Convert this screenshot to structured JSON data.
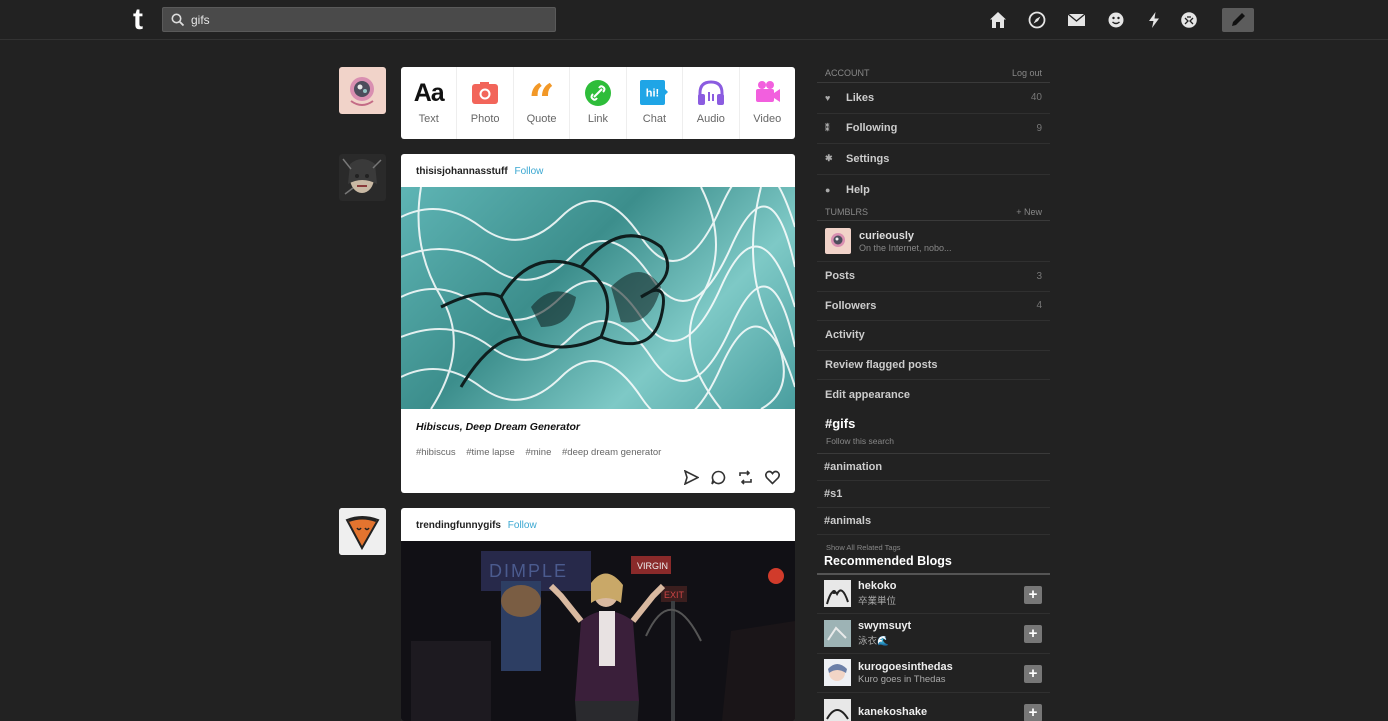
{
  "header": {
    "logo_text": "t",
    "search_value": "gifs",
    "nav_icons": [
      "home-icon",
      "explore-icon",
      "mail-icon",
      "emoji-icon",
      "bolt-icon",
      "account-icon",
      "compose-pencil-icon"
    ]
  },
  "composer": {
    "types": [
      {
        "label": "Text",
        "color": "#111111"
      },
      {
        "label": "Photo",
        "color": "#f2655a"
      },
      {
        "label": "Quote",
        "color": "#f29827"
      },
      {
        "label": "Link",
        "color": "#2ebd3a"
      },
      {
        "label": "Chat",
        "color": "#1fa5e6"
      },
      {
        "label": "Audio",
        "color": "#8b5ce0"
      },
      {
        "label": "Video",
        "color": "#f25fde"
      }
    ]
  },
  "posts": [
    {
      "author": "thisisjohannasstuff",
      "follow": "Follow",
      "caption": "Hibiscus, Deep Dream Generator",
      "tags": [
        "#hibiscus",
        "#time lapse",
        "#mine",
        "#deep dream generator"
      ]
    },
    {
      "author": "trendingfunnygifs",
      "follow": "Follow",
      "sign_text": "DIMPLE",
      "virgin_text": "VIRGIN",
      "exit_text": "EXIT"
    }
  ],
  "sidebar": {
    "account_label": "Account",
    "logout": "Log out",
    "account_rows": [
      {
        "label": "Likes",
        "count": "40"
      },
      {
        "label": "Following",
        "count": "9"
      },
      {
        "label": "Settings",
        "count": ""
      },
      {
        "label": "Help",
        "count": ""
      }
    ],
    "tumblrs_label": "Tumblrs",
    "new_label": "+ New",
    "blog": {
      "name": "curieously",
      "desc": "On the Internet, nobo..."
    },
    "blog_rows": [
      {
        "label": "Posts",
        "count": "3"
      },
      {
        "label": "Followers",
        "count": "4"
      },
      {
        "label": "Activity",
        "count": ""
      },
      {
        "label": "Review flagged posts",
        "count": ""
      },
      {
        "label": "Edit appearance",
        "count": ""
      }
    ],
    "search_tag": "#gifs",
    "follow_search": "Follow this search",
    "related_tags": [
      "#animation",
      "#s1",
      "#animals"
    ],
    "show_related": "Show All Related Tags",
    "recommended_title": "Recommended Blogs",
    "recommended": [
      {
        "name": "hekoko",
        "sub": "卒業単位"
      },
      {
        "name": "swymsuyt",
        "sub": "泳衣🌊"
      },
      {
        "name": "kurogoesinthedas",
        "sub": "Kuro goes in Thedas"
      },
      {
        "name": "kanekoshake",
        "sub": ""
      }
    ]
  }
}
